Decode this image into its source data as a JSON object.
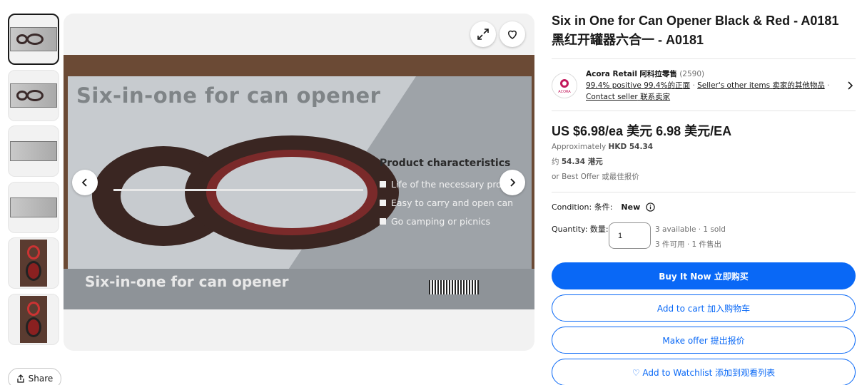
{
  "gallery": {
    "thumbnail_count": 6,
    "photo": {
      "headline": "Six-in-one for can opener",
      "characteristics_title": "Product characteristics",
      "characteristics": [
        "Life of the necessary produc",
        "Easy to carry and open can",
        "Go camping or picnics"
      ],
      "band_text": "Six-in-one for can opener"
    }
  },
  "share_label": "Share",
  "listing": {
    "title_line1": "Six in One for Can Opener Black & Red - A0181",
    "title_line2": "黑红开罐器六合一 - A0181",
    "seller": {
      "name": "Acora Retail",
      "name_cn": "阿科拉零售",
      "feedback_count": "(2590)",
      "positive": "99.4% positive",
      "positive_cn": "99.4%的正面",
      "other_items": "Seller's other items",
      "other_items_cn": "卖家的其他物品",
      "contact": "Contact seller",
      "contact_cn": "联系卖家",
      "logo_text": "ACORA"
    },
    "price": "US $6.98/ea  美元 6.98 美元/EA",
    "approx": "Approximately",
    "approx_value": "HKD 54.34",
    "approx_cn": "约",
    "approx_cn_value": "54.34 港元",
    "best_offer": "or Best Offer  或最佳报价",
    "condition_label": "Condition:  条件:",
    "condition_value": "New",
    "quantity_label": "Quantity:  数量:",
    "quantity_value": "1",
    "availability": "3 available · 1 sold",
    "availability_cn": "3 件可用 · 1 件售出",
    "buttons": {
      "buy_now": "Buy It Now  立即购买",
      "add_to_cart": "Add to cart  加入购物车",
      "make_offer": "Make offer  提出报价",
      "watchlist": "♡ Add to Watchlist  添加到观看列表"
    }
  }
}
